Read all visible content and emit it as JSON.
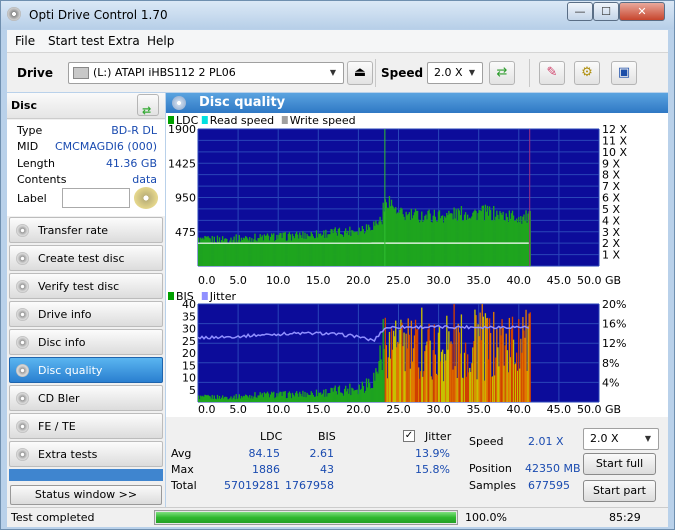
{
  "window": {
    "title": "Opti Drive Control 1.70",
    "min": "—",
    "max": "☐",
    "close": "✕"
  },
  "menu": [
    "File",
    "Start test",
    "Extra",
    "Help"
  ],
  "toolbar": {
    "drive_label": "Drive",
    "drive_value": "(L:)   ATAPI iHBS112   2 PL06",
    "speed_label": "Speed",
    "speed_value": "2.0 X"
  },
  "disc": {
    "header": "Disc",
    "rows": [
      {
        "k": "Type",
        "v": "BD-R DL"
      },
      {
        "k": "MID",
        "v": "CMCMAGDI6 (000)"
      },
      {
        "k": "Length",
        "v": "41.36 GB"
      },
      {
        "k": "Contents",
        "v": "data"
      }
    ],
    "label_key": "Label",
    "label_value": ""
  },
  "nav": [
    {
      "label": "Transfer rate",
      "active": false
    },
    {
      "label": "Create test disc",
      "active": false
    },
    {
      "label": "Verify test disc",
      "active": false
    },
    {
      "label": "Drive info",
      "active": false
    },
    {
      "label": "Disc info",
      "active": false
    },
    {
      "label": "Disc quality",
      "active": true
    },
    {
      "label": "CD Bler",
      "active": false
    },
    {
      "label": "FE / TE",
      "active": false
    },
    {
      "label": "Extra tests",
      "active": false
    }
  ],
  "status_window_btn": "Status window >>",
  "panel_title": "Disc quality",
  "chart_data": [
    {
      "type": "area",
      "legend": [
        "LDC",
        "Read speed",
        "Write speed"
      ],
      "legend_colors": [
        "#00a000",
        "#00e0e0",
        "#a0a0a0"
      ],
      "xlim": [
        0,
        50
      ],
      "x_ticks": [
        "0.0",
        "5.0",
        "10.0",
        "15.0",
        "20.0",
        "25.0",
        "30.0",
        "35.0",
        "40.0",
        "45.0",
        "50.0 GB"
      ],
      "y_ticks": [
        "1900",
        "1425",
        "950",
        "475"
      ],
      "ylim": [
        0,
        1900
      ],
      "y2_ticks": [
        "12 X",
        "11 X",
        "10 X",
        "9 X",
        "8 X",
        "7 X",
        "6 X",
        "5 X",
        "4 X",
        "3 X",
        "2 X",
        "1 X"
      ],
      "y2lim": [
        0,
        12
      ],
      "series": [
        {
          "name": "LDC",
          "x": [
            0,
            2,
            4,
            6,
            8,
            10,
            12,
            14,
            16,
            18,
            20,
            21,
            22,
            22.5,
            23.2,
            23.6,
            24,
            26,
            28,
            30,
            32,
            34,
            36,
            38,
            40,
            41.36
          ],
          "y": [
            370,
            380,
            390,
            400,
            410,
            420,
            430,
            450,
            470,
            490,
            520,
            560,
            600,
            640,
            720,
            870,
            760,
            720,
            720,
            720,
            740,
            760,
            760,
            720,
            700,
            690
          ]
        },
        {
          "name": "Read speed",
          "x": [
            0,
            5,
            10,
            15,
            20,
            21.5,
            22.5,
            23.3,
            41.36
          ],
          "y": [
            2.0,
            2.0,
            2.0,
            2.0,
            2.0,
            2.0,
            2.01,
            2.01,
            2.01
          ]
        }
      ],
      "markers": [
        {
          "x": 23.3
        },
        {
          "x": 41.36
        }
      ]
    },
    {
      "type": "area",
      "legend": [
        "BIS",
        "Jitter"
      ],
      "legend_colors": [
        "#00a000",
        "#9090ff"
      ],
      "xlim": [
        0,
        50
      ],
      "x_ticks": [
        "0.0",
        "5.0",
        "10.0",
        "15.0",
        "20.0",
        "25.0",
        "30.0",
        "35.0",
        "40.0",
        "45.0",
        "50.0 GB"
      ],
      "y_ticks": [
        "40",
        "35",
        "30",
        "25",
        "20",
        "15",
        "10",
        "5"
      ],
      "ylim": [
        0,
        40
      ],
      "y2_ticks": [
        "20%",
        "16%",
        "12%",
        "8%",
        "4%"
      ],
      "y2lim": [
        0,
        20
      ],
      "series": [
        {
          "name": "BIS",
          "x": [
            0,
            4,
            8,
            12,
            16,
            20,
            22,
            23.3,
            24,
            26,
            28,
            30,
            32,
            34,
            36,
            38,
            40,
            41.36
          ],
          "y": [
            2,
            2,
            3,
            3,
            4,
            6,
            10,
            28,
            26,
            25,
            25,
            25,
            26,
            26,
            26,
            27,
            28,
            27
          ]
        },
        {
          "name": "Jitter",
          "x": [
            0,
            4,
            8,
            12,
            16,
            20,
            21,
            22,
            23,
            23.5,
            25,
            30,
            35,
            40,
            41.36
          ],
          "y": [
            13.1,
            13.3,
            13.7,
            14.0,
            14.0,
            13.4,
            12.8,
            12.6,
            14.6,
            15.2,
            15.3,
            15.3,
            15.3,
            15.3,
            15.3
          ]
        }
      ]
    }
  ],
  "stats": {
    "ldc_header": "LDC",
    "bis_header": "BIS",
    "jitter_header": "Jitter",
    "avg_label": "Avg",
    "max_label": "Max",
    "total_label": "Total",
    "ldc_avg": "84.15",
    "ldc_max": "1886",
    "ldc_total": "57019281",
    "bis_avg": "2.61",
    "bis_max": "43",
    "bis_total": "1767958",
    "jitter_avg": "13.9%",
    "jitter_max": "15.8%",
    "jitter_checked": "✓",
    "speed_label": "Speed",
    "speed_value": "2.01 X",
    "position_label": "Position",
    "position_value": "42350 MB",
    "samples_label": "Samples",
    "samples_value": "677595",
    "speed_select": "2.0 X",
    "start_full": "Start full",
    "start_part": "Start part"
  },
  "status": {
    "text": "Test completed",
    "percent_text": "100.0%",
    "progress": 1.0,
    "time": "85:29"
  }
}
